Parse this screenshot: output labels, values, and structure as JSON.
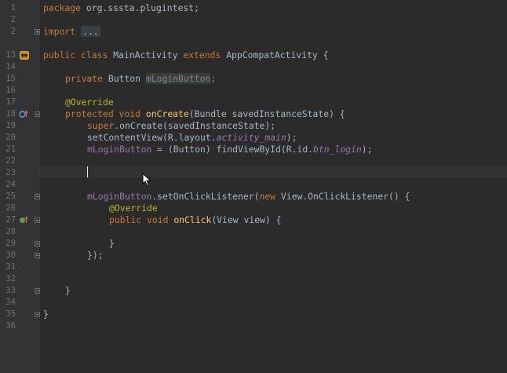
{
  "editor": {
    "line_numbers": [
      "1",
      "2",
      "3",
      "13",
      "14",
      "15",
      "16",
      "17",
      "18",
      "19",
      "20",
      "21",
      "22",
      "23",
      "24",
      "25",
      "26",
      "27",
      "28",
      "29",
      "30",
      "31",
      "32",
      "33",
      "34",
      "35",
      "36"
    ],
    "lines": {
      "l1_kw": "package",
      "l1_rest": " org.sssta.plugintest;",
      "l3_kw": "import",
      "l3_folded": "...",
      "l13_kw1": "public",
      "l13_kw2": "class",
      "l13_name": " MainActivity ",
      "l13_kw3": "extends",
      "l13_rest": " AppCompatActivity {",
      "l15_kw": "private",
      "l15_type": " Button ",
      "l15_field": "mLoginButton",
      "l15_end": ";",
      "l17_ann": "@Override",
      "l18_kw1": "protected",
      "l18_kw2": "void",
      "l18_method": "onCreate",
      "l18_rest": "(Bundle savedInstanceState) {",
      "l19_kw": "super",
      "l19_rest": ".onCreate(savedInstanceState);",
      "l20_a": "setContentView(R.layout.",
      "l20_static": "activity_main",
      "l20_b": ");",
      "l21_field": "mLoginButton",
      "l21_a": " = (Button) findViewById(R.id.",
      "l21_static": "btn_login",
      "l21_b": ");",
      "l25_field": "mLoginButton",
      "l25_a": ".setOnClickListener(",
      "l25_kw": "new",
      "l25_b": " View.OnClickListener() {",
      "l26_ann": "@Override",
      "l27_kw1": "public",
      "l27_kw2": "void",
      "l27_method": "onClick",
      "l27_rest": "(View view) {",
      "l29": "}",
      "l30": "});",
      "l33": "}",
      "l35": "}"
    }
  },
  "colors": {
    "background": "#2b2b2b",
    "gutter": "#313335",
    "keyword": "#cc7832",
    "annotation": "#bbb529",
    "field": "#9876aa",
    "method": "#ffc66d",
    "text": "#a9b7c6"
  },
  "icons": {
    "class_marker": "class-icon",
    "override_marker": "override-up-icon",
    "implement_marker": "implement-icon",
    "fold": "fold-icon",
    "mouse": "mouse-pointer-icon"
  }
}
